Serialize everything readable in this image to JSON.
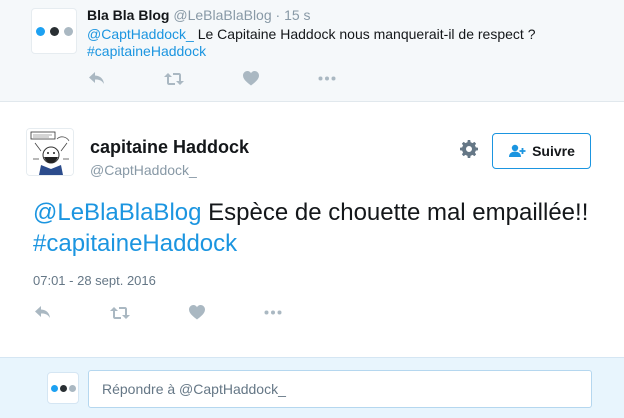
{
  "parent_tweet": {
    "author_name": "Bla Bla Blog",
    "author_handle": "@LeBlaBlaBlog",
    "separator": "·",
    "time": "15 s",
    "mention": "@CaptHaddock_",
    "text": " Le Capitaine Haddock nous manquerait-il de respect ?",
    "hashtag": "#capitaineHaddock",
    "avatar_dot_colors": [
      "#1da1f2",
      "#292f33",
      "#aab8c2"
    ]
  },
  "main_tweet": {
    "author_name": "capitaine Haddock",
    "author_handle": "@CaptHaddock_",
    "follow_label": "Suivre",
    "mention": "@LeBlaBlaBlog",
    "text_part1": " Espèce de chouette mal empaillée!! ",
    "hashtag": "#capitaineHaddock",
    "timestamp": "07:01 - 28 sept. 2016"
  },
  "reply": {
    "placeholder": "Répondre à @CaptHaddock_"
  },
  "icons": {
    "reply": "reply-icon",
    "retweet": "retweet-icon",
    "like": "heart-icon",
    "more": "more-icon",
    "settings": "gear-icon",
    "follow": "follow-user-icon"
  },
  "colors": {
    "link": "#1b95e0",
    "muted": "#8899a6",
    "action_icon": "#aab8c2",
    "parent_bg": "#f5f8fa",
    "reply_bg": "#e8f5fd"
  }
}
